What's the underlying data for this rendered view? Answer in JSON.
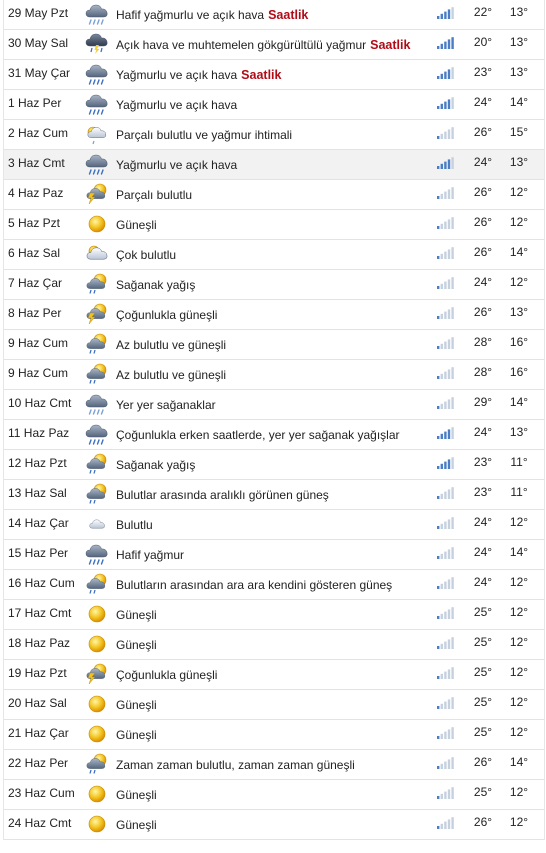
{
  "colors": {
    "saatlik": "#b00b17",
    "signal_active": "#4a7dc4",
    "signal_inactive": "#c6d1df"
  },
  "forecast": [
    {
      "date": "29 May Pzt",
      "icon": "cloud-drizzle-icon",
      "desc": "Hafif yağmurlu ve açık hava",
      "link": "Saatlik",
      "signal": 4,
      "hi": "22°",
      "lo": "13°"
    },
    {
      "date": "30 May Sal",
      "icon": "thunder-rain-icon",
      "desc": "Açık hava ve muhtemelen gökgürültülü yağmur",
      "link": "Saatlik",
      "signal": 5,
      "hi": "20°",
      "lo": "13°"
    },
    {
      "date": "31 May Çar",
      "icon": "cloud-rain-icon",
      "desc": "Yağmurlu ve açık hava",
      "link": "Saatlik",
      "signal": 4,
      "hi": "23°",
      "lo": "13°"
    },
    {
      "date": "1 Haz Per",
      "icon": "cloud-rain-icon",
      "desc": "Yağmurlu ve açık hava",
      "link": "",
      "signal": 4,
      "hi": "24°",
      "lo": "14°"
    },
    {
      "date": "2 Haz Cum",
      "icon": "partly-cloudy-rain-icon",
      "desc": "Parçalı bulutlu ve yağmur ihtimali",
      "link": "",
      "signal": 1,
      "hi": "26°",
      "lo": "15°"
    },
    {
      "date": "3 Haz Cmt",
      "icon": "cloud-rain-icon",
      "desc": "Yağmurlu ve açık hava",
      "link": "",
      "signal": 4,
      "hi": "24°",
      "lo": "13°"
    },
    {
      "date": "4 Haz Paz",
      "icon": "sun-cloud-lightning-icon",
      "desc": "Parçalı bulutlu",
      "link": "",
      "signal": 1,
      "hi": "26°",
      "lo": "12°"
    },
    {
      "date": "5 Haz Pzt",
      "icon": "sun-icon",
      "desc": "Güneşli",
      "link": "",
      "signal": 1,
      "hi": "26°",
      "lo": "12°"
    },
    {
      "date": "6 Haz Sal",
      "icon": "mostly-cloudy-icon",
      "desc": "Çok bulutlu",
      "link": "",
      "signal": 1,
      "hi": "26°",
      "lo": "14°"
    },
    {
      "date": "7 Haz Çar",
      "icon": "sun-cloud-rain-icon",
      "desc": "Sağanak yağış",
      "link": "",
      "signal": 1,
      "hi": "24°",
      "lo": "12°"
    },
    {
      "date": "8 Haz Per",
      "icon": "sun-cloud-lightning-icon",
      "desc": "Çoğunlukla güneşli",
      "link": "",
      "signal": 1,
      "hi": "26°",
      "lo": "13°"
    },
    {
      "date": "9 Haz Cum",
      "icon": "sun-cloud-rain-icon",
      "desc": "Az bulutlu ve güneşli",
      "link": "",
      "signal": 1,
      "hi": "28°",
      "lo": "16°"
    },
    {
      "date": "9 Haz Cum",
      "icon": "sun-cloud-rain-icon",
      "desc": "Az bulutlu ve güneşli",
      "link": "",
      "signal": 1,
      "hi": "28°",
      "lo": "16°"
    },
    {
      "date": "10 Haz Cmt",
      "icon": "cloud-drizzle-icon",
      "desc": "Yer yer sağanaklar",
      "link": "",
      "signal": 1,
      "hi": "29°",
      "lo": "14°"
    },
    {
      "date": "11 Haz Paz",
      "icon": "cloud-rain-icon",
      "desc": "Çoğunlukla erken saatlerde, yer yer sağanak yağışlar",
      "link": "",
      "signal": 4,
      "hi": "24°",
      "lo": "13°"
    },
    {
      "date": "12 Haz Pzt",
      "icon": "sun-cloud-rain-icon",
      "desc": "Sağanak yağış",
      "link": "",
      "signal": 4,
      "hi": "23°",
      "lo": "11°"
    },
    {
      "date": "13 Haz Sal",
      "icon": "sun-cloud-rain-icon",
      "desc": "Bulutlar arasında aralıklı görünen güneş",
      "link": "",
      "signal": 1,
      "hi": "23°",
      "lo": "11°"
    },
    {
      "date": "14 Haz Çar",
      "icon": "cloud-icon",
      "desc": "Bulutlu",
      "link": "",
      "signal": 1,
      "hi": "24°",
      "lo": "12°"
    },
    {
      "date": "15 Haz Per",
      "icon": "cloud-rain-icon",
      "desc": "Hafif yağmur",
      "link": "",
      "signal": 1,
      "hi": "24°",
      "lo": "14°"
    },
    {
      "date": "16 Haz Cum",
      "icon": "sun-cloud-rain-icon",
      "desc": "Bulutların arasından ara ara kendini gösteren güneş",
      "link": "",
      "signal": 1,
      "hi": "24°",
      "lo": "12°"
    },
    {
      "date": "17 Haz Cmt",
      "icon": "sun-icon",
      "desc": "Güneşli",
      "link": "",
      "signal": 1,
      "hi": "25°",
      "lo": "12°"
    },
    {
      "date": "18 Haz Paz",
      "icon": "sun-icon",
      "desc": "Güneşli",
      "link": "",
      "signal": 1,
      "hi": "25°",
      "lo": "12°"
    },
    {
      "date": "19 Haz Pzt",
      "icon": "sun-cloud-lightning-icon",
      "desc": "Çoğunlukla güneşli",
      "link": "",
      "signal": 1,
      "hi": "25°",
      "lo": "12°"
    },
    {
      "date": "20 Haz Sal",
      "icon": "sun-icon",
      "desc": "Güneşli",
      "link": "",
      "signal": 1,
      "hi": "25°",
      "lo": "12°"
    },
    {
      "date": "21 Haz Çar",
      "icon": "sun-icon",
      "desc": "Güneşli",
      "link": "",
      "signal": 1,
      "hi": "25°",
      "lo": "12°"
    },
    {
      "date": "22 Haz Per",
      "icon": "sun-cloud-rain-icon",
      "desc": "Zaman zaman bulutlu, zaman zaman güneşli",
      "link": "",
      "signal": 1,
      "hi": "26°",
      "lo": "14°"
    },
    {
      "date": "23 Haz Cum",
      "icon": "sun-icon",
      "desc": "Güneşli",
      "link": "",
      "signal": 1,
      "hi": "25°",
      "lo": "12°"
    },
    {
      "date": "24 Haz Cmt",
      "icon": "sun-icon",
      "desc": "Güneşli",
      "link": "",
      "signal": 1,
      "hi": "26°",
      "lo": "12°"
    }
  ]
}
